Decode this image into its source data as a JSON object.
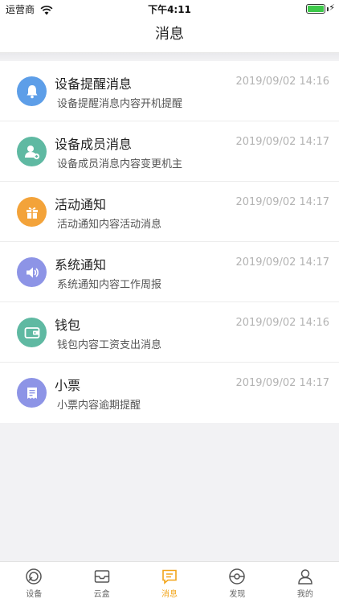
{
  "status_bar": {
    "carrier": "运营商",
    "time": "下午4:11"
  },
  "nav": {
    "title": "消息"
  },
  "messages": [
    {
      "title": "设备提醒消息",
      "time": "2019/09/02 14:16",
      "subtitle": "设备提醒消息内容开机提醒",
      "icon": "bell-icon",
      "color": "#5d9ee8"
    },
    {
      "title": "设备成员消息",
      "time": "2019/09/02 14:17",
      "subtitle": "设备成员消息内容变更机主",
      "icon": "member-icon",
      "color": "#5fb9a2"
    },
    {
      "title": "活动通知",
      "time": "2019/09/02 14:17",
      "subtitle": "活动通知内容活动消息",
      "icon": "gift-icon",
      "color": "#f3a33a"
    },
    {
      "title": "系统通知",
      "time": "2019/09/02 14:17",
      "subtitle": "系统通知内容工作周报",
      "icon": "speaker-icon",
      "color": "#8d94e6"
    },
    {
      "title": "钱包",
      "time": "2019/09/02 14:16",
      "subtitle": "钱包内容工资支出消息",
      "icon": "wallet-icon",
      "color": "#5fb9a2"
    },
    {
      "title": "小票",
      "time": "2019/09/02 14:17",
      "subtitle": "小票内容逾期提醒",
      "icon": "receipt-icon",
      "color": "#8d94e6"
    }
  ],
  "tabs": [
    {
      "label": "设备",
      "icon": "device-icon",
      "active": false
    },
    {
      "label": "云盒",
      "icon": "cloud-box-icon",
      "active": false
    },
    {
      "label": "消息",
      "icon": "message-icon",
      "active": true
    },
    {
      "label": "发现",
      "icon": "discover-icon",
      "active": false
    },
    {
      "label": "我的",
      "icon": "profile-icon",
      "active": false
    }
  ],
  "colors": {
    "accent": "#f2a51a",
    "tab_inactive": "#666666"
  }
}
